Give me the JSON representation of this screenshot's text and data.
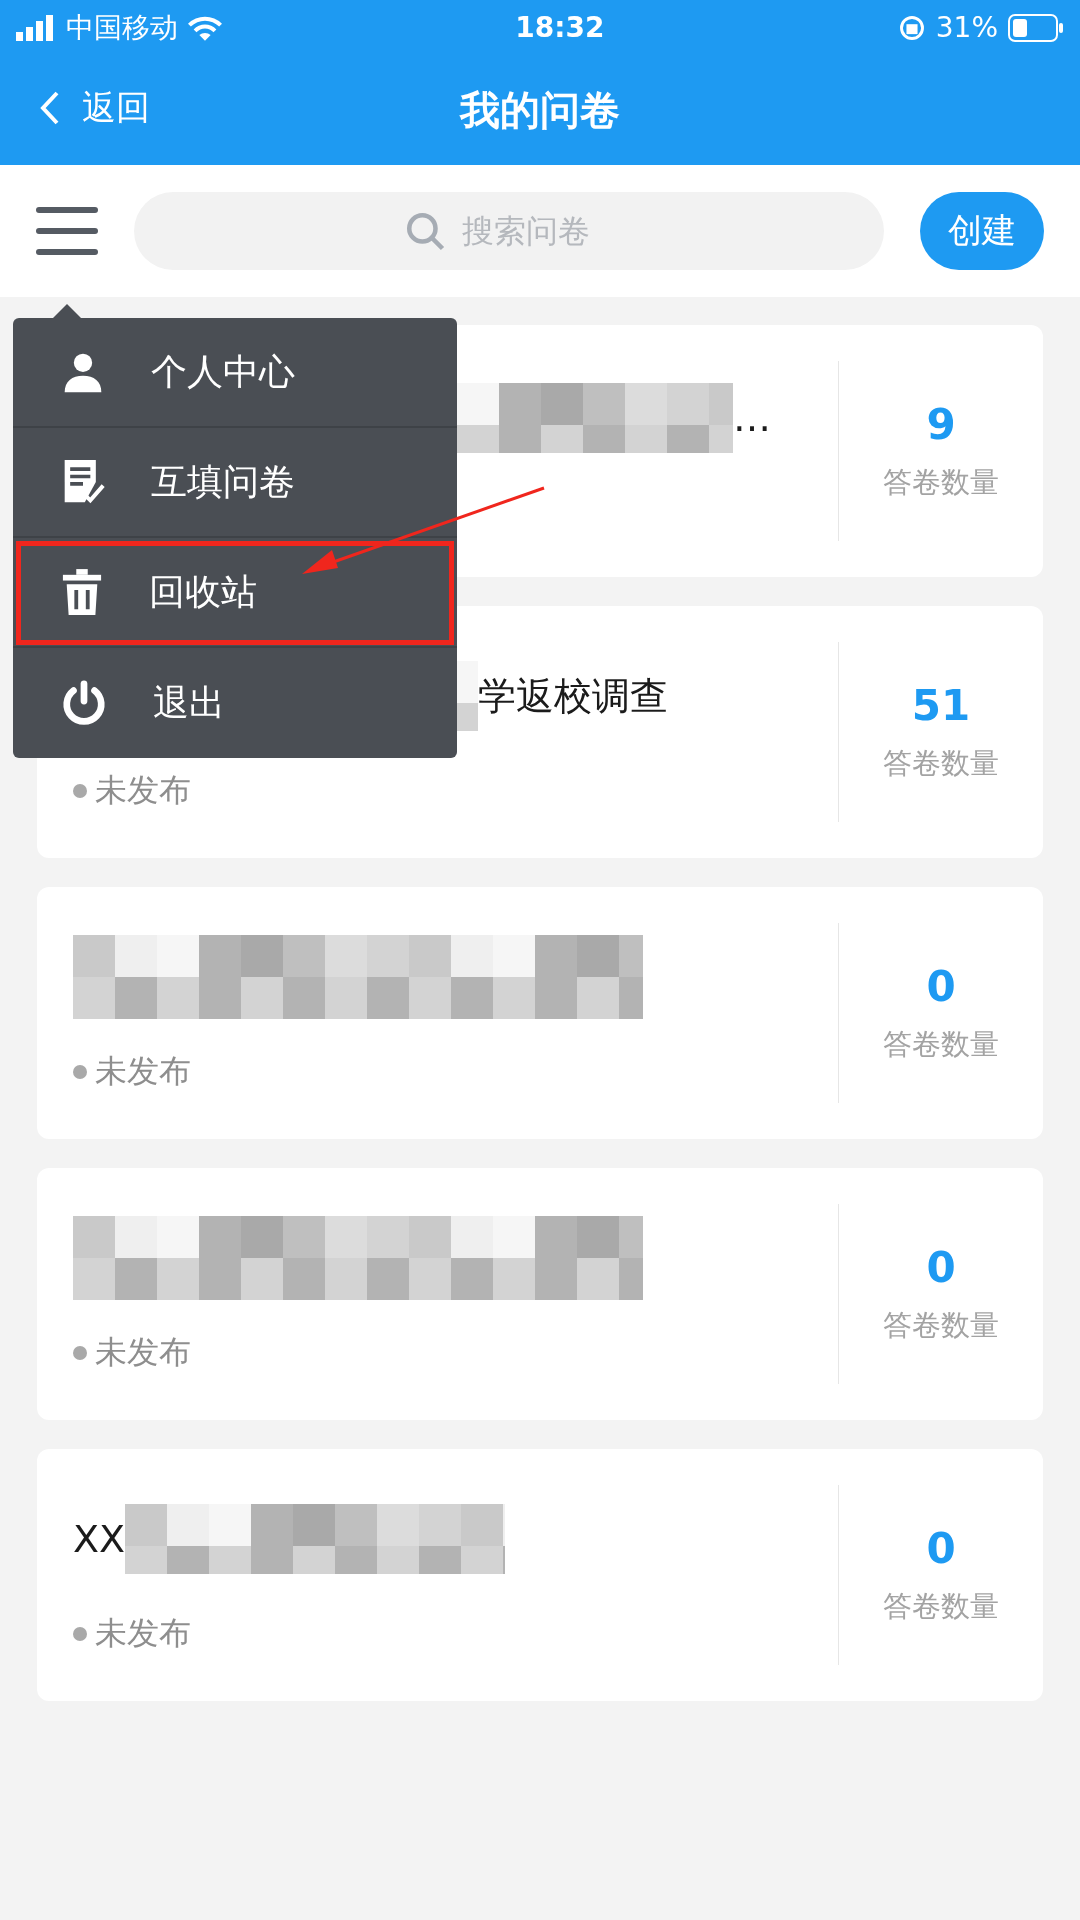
{
  "status_bar": {
    "carrier": "中国移动",
    "time": "18:32",
    "battery": "31%"
  },
  "header": {
    "back": "返回",
    "title": "我的问卷"
  },
  "toolbar": {
    "search_placeholder": "搜索问卷",
    "create": "创建"
  },
  "surveys": [
    {
      "tail": "…",
      "count": "9",
      "count_label": "答卷数量"
    },
    {
      "tail": "学返校调查",
      "status": "未发布",
      "count": "51",
      "count_label": "答卷数量"
    },
    {
      "status": "未发布",
      "count": "0",
      "count_label": "答卷数量"
    },
    {
      "status": "未发布",
      "count": "0",
      "count_label": "答卷数量"
    },
    {
      "lead": "XX",
      "status": "未发布",
      "count": "0",
      "count_label": "答卷数量"
    }
  ],
  "menu": {
    "items": [
      {
        "kind": "person",
        "label": "个人中心",
        "highlighted": false
      },
      {
        "kind": "form",
        "label": "互填问卷",
        "highlighted": false
      },
      {
        "kind": "trash",
        "label": "回收站",
        "highlighted": true
      },
      {
        "kind": "power",
        "label": "退出",
        "highlighted": false
      }
    ]
  }
}
